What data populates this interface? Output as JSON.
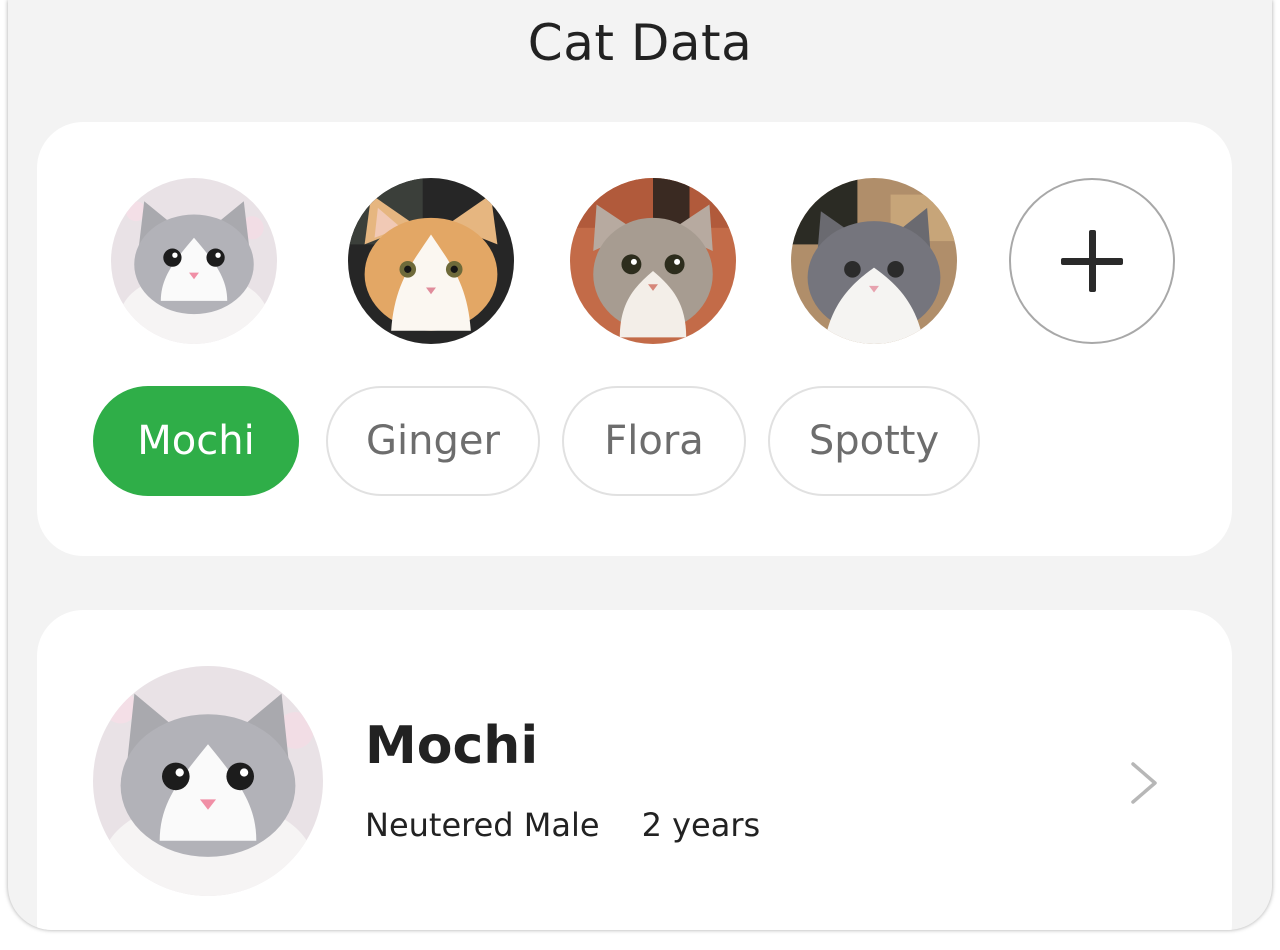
{
  "header": {
    "title": "Cat Data"
  },
  "cats": [
    {
      "name": "Mochi",
      "active": true
    },
    {
      "name": "Ginger",
      "active": false
    },
    {
      "name": "Flora",
      "active": false
    },
    {
      "name": "Spotty",
      "active": false
    }
  ],
  "add_button": {
    "icon": "plus-icon"
  },
  "selected": {
    "name": "Mochi",
    "sex": "Neutered Male",
    "age": "2 years",
    "chevron_icon": "chevron-right-icon"
  },
  "colors": {
    "accent": "#2fae48",
    "background": "#f3f3f3",
    "card": "#ffffff",
    "chip_border": "#e1e1e1",
    "chip_text": "#6d6d6d"
  }
}
